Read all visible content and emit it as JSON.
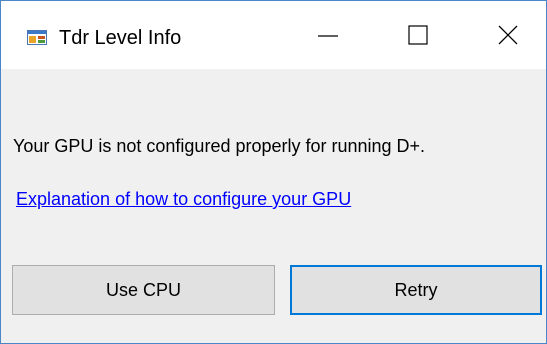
{
  "window": {
    "title": "Tdr Level Info",
    "app_icon": "window-app-icon",
    "controls": {
      "minimize": "minimize-icon",
      "maximize": "maximize-icon",
      "close": "close-icon"
    }
  },
  "dialog": {
    "message": "Your GPU is not configured properly for running D+.",
    "link_text": "Explanation of how to configure your GPU",
    "buttons": {
      "use_cpu": "Use CPU",
      "retry": "Retry"
    },
    "default_button": "retry"
  },
  "colors": {
    "window_border": "#4a86c8",
    "titlebar_bg": "#ffffff",
    "client_bg": "#f0f0f0",
    "link": "#0000ff",
    "button_bg": "#e1e1e1",
    "default_button_border": "#0078d7"
  }
}
